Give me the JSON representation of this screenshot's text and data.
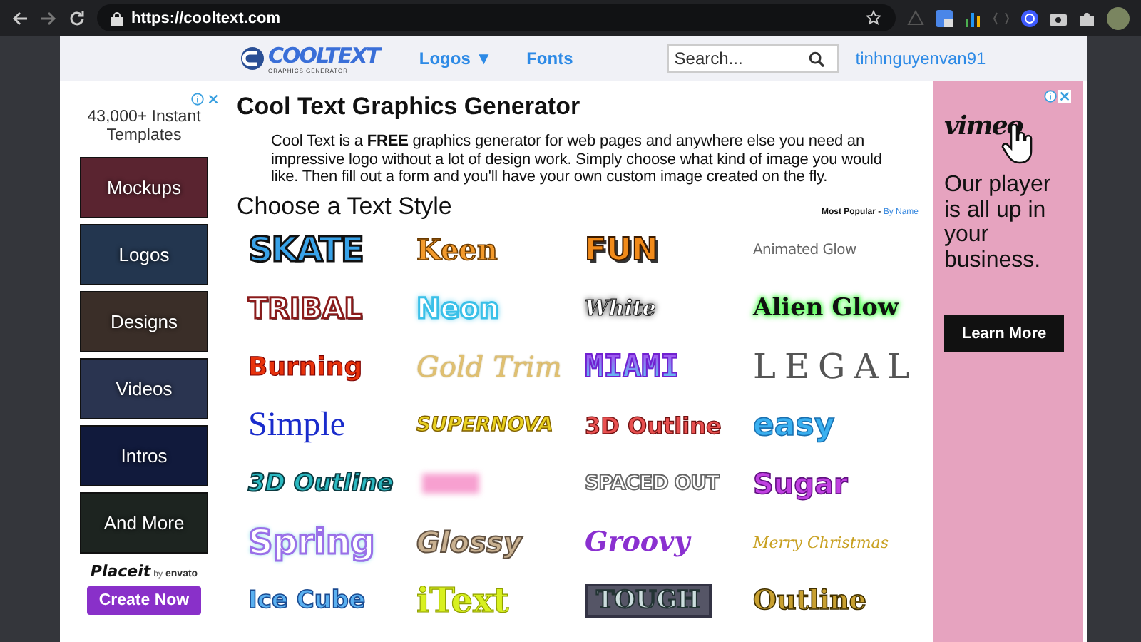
{
  "browser": {
    "url": "https://cooltext.com"
  },
  "header": {
    "logo_text": "COOLTEXT",
    "logo_subtext": "GRAPHICS GENERATOR",
    "nav": [
      "Logos ▼",
      "Fonts"
    ],
    "search": {
      "placeholder": "Search..."
    },
    "user": "tinhnguyenvan91"
  },
  "left_ad": {
    "headline": "43,000+ Instant Templates",
    "tiles": [
      "Mockups",
      "Logos",
      "Designs",
      "Videos",
      "Intros",
      "And More"
    ],
    "brand": "Placeit",
    "brand_by": "by",
    "brand_parent": "envato",
    "button": "Create Now"
  },
  "main": {
    "title": "Cool Text Graphics Generator",
    "intro": "Cool Text is a **FREE** graphics generator for web pages and anywhere else you need an impressive logo without a lot of design work. Simply choose what kind of image you would like. Then fill out a form and you'll have your own custom image created on the fly.",
    "section_title": "Choose a Text Style",
    "sort_label": "Most Popular - ",
    "sort_link": "By Name",
    "styles": [
      {
        "kind": "text",
        "label": "SKATE"
      },
      {
        "kind": "text",
        "label": "Keen"
      },
      {
        "kind": "text",
        "label": "FUN"
      },
      {
        "kind": "text",
        "label": "Animated Glow"
      },
      {
        "kind": "text",
        "label": "TRIBAL"
      },
      {
        "kind": "text",
        "label": "Neon"
      },
      {
        "kind": "text",
        "label": "White"
      },
      {
        "kind": "text",
        "label": "Alien Glow"
      },
      {
        "kind": "text",
        "label": "Burning"
      },
      {
        "kind": "text",
        "label": "Gold Trim"
      },
      {
        "kind": "text",
        "label": "MIAMI"
      },
      {
        "kind": "text",
        "label": "LEGAL"
      },
      {
        "kind": "text",
        "label": "Simple"
      },
      {
        "kind": "text",
        "label": "SUPERNOVA"
      },
      {
        "kind": "text",
        "label": "3D Outline"
      },
      {
        "kind": "text",
        "label": "easy"
      },
      {
        "kind": "text",
        "label": "3D Outline"
      },
      {
        "kind": "blur"
      },
      {
        "kind": "text",
        "label": "SPACED OUT"
      },
      {
        "kind": "text",
        "label": "Sugar"
      },
      {
        "kind": "text",
        "label": "Spring"
      },
      {
        "kind": "text",
        "label": "Glossy"
      },
      {
        "kind": "text",
        "label": "Groovy"
      },
      {
        "kind": "text",
        "label": "Merry Christmas"
      },
      {
        "kind": "text",
        "label": "Ice Cube"
      },
      {
        "kind": "text",
        "label": "iText"
      },
      {
        "kind": "text",
        "label": "TOUGH"
      },
      {
        "kind": "text",
        "label": "Outline"
      }
    ]
  },
  "right_ad": {
    "brand": "vimeo",
    "message": "Our player is all up in your business.",
    "button": "Learn More"
  }
}
